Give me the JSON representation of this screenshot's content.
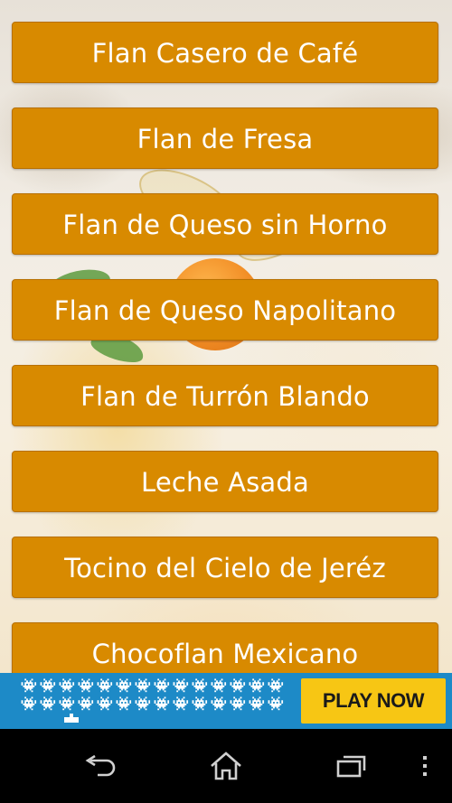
{
  "recipes": [
    {
      "label": "Flan Casero de Café"
    },
    {
      "label": "Flan de Fresa"
    },
    {
      "label": "Flan de Queso sin Horno"
    },
    {
      "label": "Flan de Queso Napolitano"
    },
    {
      "label": "Flan de Turrón Blando"
    },
    {
      "label": "Leche Asada"
    },
    {
      "label": "Tocino del Cielo de Jeréz"
    },
    {
      "label": "Chocoflan Mexicano"
    }
  ],
  "ad": {
    "cta_label": "PLAY NOW",
    "invader_glyph": "👾",
    "colors": {
      "background": "#1d8ac7",
      "cta": "#f7c614"
    }
  },
  "nav_bar": {
    "icons": [
      "back-icon",
      "home-icon",
      "recents-icon",
      "overflow-menu-icon"
    ]
  },
  "colors": {
    "button": "#d88a00",
    "button_text": "#ffffff"
  }
}
